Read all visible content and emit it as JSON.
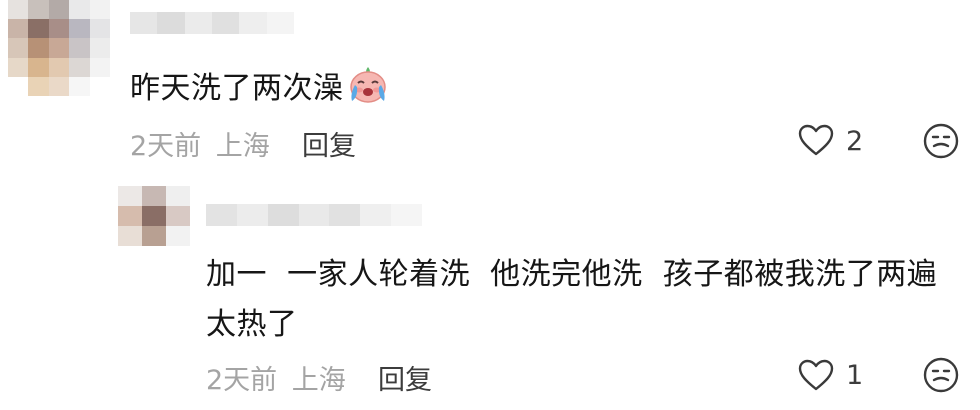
{
  "colors": {
    "text": "#161616",
    "meta": "#a4a4a4",
    "reply": "#3c3c3c",
    "icon": "#3a3a3a"
  },
  "comment1": {
    "text": "昨天洗了两次澡",
    "emoji_icon": "crying-face-emoji-icon",
    "time": "2天前",
    "location": "上海",
    "reply_label": "回复",
    "like_icon": "heart-outline-icon",
    "like_count": "2",
    "dislike_icon": "meh-face-icon"
  },
  "comment2": {
    "text_line1": "加一  一家人轮着洗  他洗完他洗  孩子都被我洗了两遍",
    "text_line2": "太热了",
    "time": "2天前",
    "location": "上海",
    "reply_label": "回复",
    "like_icon": "heart-outline-icon",
    "like_count": "1",
    "dislike_icon": "meh-face-icon"
  }
}
